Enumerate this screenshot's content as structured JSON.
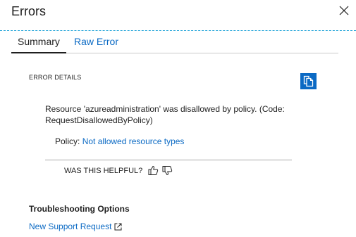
{
  "header": {
    "title": "Errors",
    "close_icon": "close-icon"
  },
  "tabs": [
    {
      "label": "Summary",
      "active": true
    },
    {
      "label": "Raw Error",
      "active": false
    }
  ],
  "error_details": {
    "section_label": "ERROR DETAILS",
    "copy_icon": "copy-icon",
    "message": "Resource 'azureadministration' was disallowed by policy. (Code: RequestDisallowedByPolicy)",
    "policy_label": "Policy:",
    "policy_link": "Not allowed resource types"
  },
  "feedback": {
    "question": "WAS THIS HELPFUL?",
    "thumbs_up_icon": "thumbs-up-icon",
    "thumbs_down_icon": "thumbs-down-icon"
  },
  "troubleshooting": {
    "heading": "Troubleshooting Options",
    "support_link": "New Support Request",
    "external_icon": "external-link-icon"
  },
  "colors": {
    "accent_blue": "#0b6ac4",
    "divider_blue": "#1fa3d8",
    "text": "#1f1f1f"
  }
}
